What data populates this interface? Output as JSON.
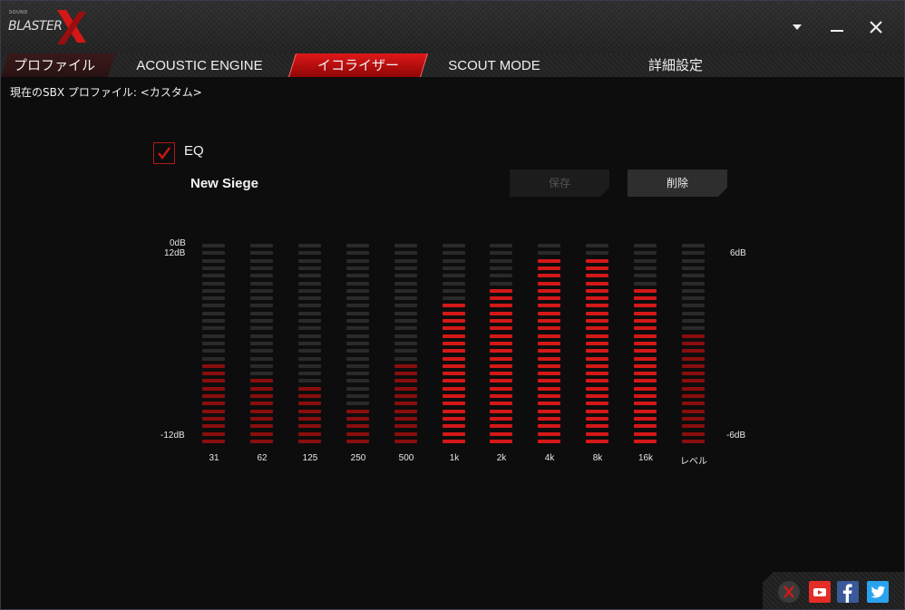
{
  "app": {
    "logo_small": "SOUND",
    "logo_text": "BLASTER",
    "colors": {
      "accent": "#d41818",
      "background": "#0c0c0c"
    }
  },
  "window_controls": {
    "menu_icon": "chevron-down-icon",
    "minimize_icon": "minimize-icon",
    "close_icon": "close-icon"
  },
  "tabs": [
    {
      "label": "プロファイル",
      "active": false
    },
    {
      "label": "ACOUSTIC ENGINE",
      "active": false
    },
    {
      "label": "イコライザー",
      "active": true
    },
    {
      "label": "SCOUT MODE",
      "active": false
    },
    {
      "label": "詳細設定",
      "active": false
    }
  ],
  "profile": {
    "current_label": "現在のSBX プロファイル: <カスタム>"
  },
  "eq": {
    "enabled": true,
    "label": "EQ",
    "preset_name": "New Siege",
    "save_label": "保存",
    "delete_label": "削除",
    "scale": {
      "top_0db": "0dB",
      "top_left": "12dB",
      "bottom_left": "-12dB",
      "top_right": "6dB",
      "bottom_right": "-6dB"
    },
    "bands": [
      {
        "label": "31",
        "lit": 11,
        "bright": false
      },
      {
        "label": "62",
        "lit": 9,
        "bright": false
      },
      {
        "label": "125",
        "lit": 8,
        "bright": false
      },
      {
        "label": "250",
        "lit": 5,
        "bright": false
      },
      {
        "label": "500",
        "lit": 11,
        "bright": false
      },
      {
        "label": "1k",
        "lit": 19,
        "bright": true
      },
      {
        "label": "2k",
        "lit": 21,
        "bright": true
      },
      {
        "label": "4k",
        "lit": 25,
        "bright": true
      },
      {
        "label": "8k",
        "lit": 25,
        "bright": true
      },
      {
        "label": "16k",
        "lit": 21,
        "bright": true
      },
      {
        "label": "レベル",
        "lit": 15,
        "bright": false
      }
    ],
    "segments_total": 27
  },
  "social": [
    {
      "name": "creative-icon"
    },
    {
      "name": "youtube-icon"
    },
    {
      "name": "facebook-icon"
    },
    {
      "name": "twitter-icon"
    }
  ]
}
